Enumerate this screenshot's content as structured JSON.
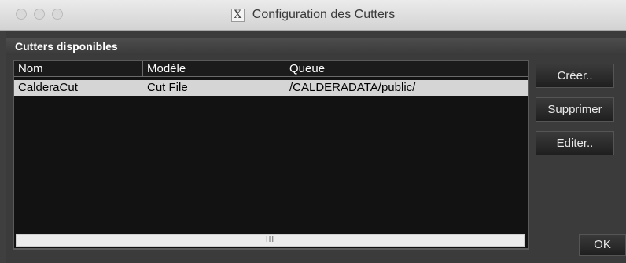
{
  "window": {
    "title": "Configuration des Cutters",
    "x_icon_glyph": "X"
  },
  "panel": {
    "header": "Cutters disponibles"
  },
  "table": {
    "columns": [
      "Nom",
      "Modèle",
      "Queue"
    ],
    "rows": [
      {
        "nom": "CalderaCut",
        "modele": "Cut File",
        "queue": "/CALDERADATA/public/"
      }
    ],
    "scroll_grip": "III"
  },
  "buttons": {
    "create": "Créer..",
    "delete": "Supprimer",
    "edit": "Editer..",
    "ok": "OK"
  }
}
